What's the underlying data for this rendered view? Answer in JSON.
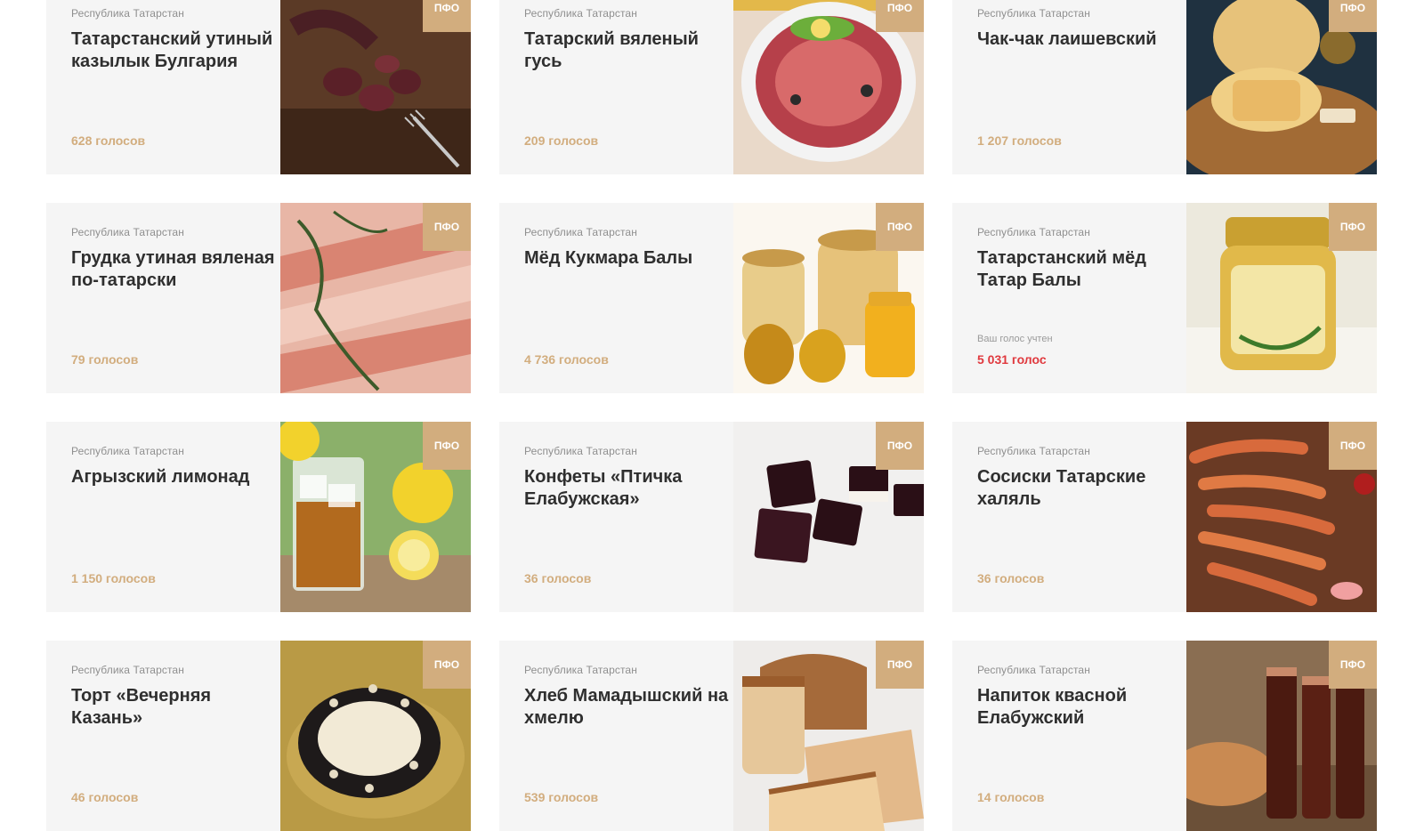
{
  "cards": [
    {
      "region": "Республика Татарстан",
      "title": "Татарстанский утиный казылык Булгария",
      "votes": "628 голосов",
      "badge": "ПФО",
      "photo": "sausage-photo",
      "voted_label": ""
    },
    {
      "region": "Республика Татарстан",
      "title": "Татарский вяленый гусь",
      "votes": "209 голосов",
      "badge": "ПФО",
      "photo": "goose-photo",
      "voted_label": ""
    },
    {
      "region": "Республика Татарстан",
      "title": "Чак-чак лаишевский",
      "votes": "1 207 голосов",
      "badge": "ПФО",
      "photo": "chak-chak-photo",
      "voted_label": ""
    },
    {
      "region": "Республика Татарстан",
      "title": "Грудка утиная вяленая по-татарски",
      "votes": "79 голосов",
      "badge": "ПФО",
      "photo": "duck-breast-photo",
      "voted_label": ""
    },
    {
      "region": "Республика Татарстан",
      "title": "Мёд Кукмара Балы",
      "votes": "4 736 голосов",
      "badge": "ПФО",
      "photo": "honey-kukmara-photo",
      "voted_label": ""
    },
    {
      "region": "Республика Татарстан",
      "title": "Татарстанский мёд Татар Балы",
      "votes": "5 031 голос",
      "badge": "ПФО",
      "photo": "honey-jar-photo",
      "voted_label": "Ваш голос учтен"
    },
    {
      "region": "Республика Татарстан",
      "title": "Агрызский лимонад",
      "votes": "1 150 голосов",
      "badge": "ПФО",
      "photo": "lemonade-photo",
      "voted_label": ""
    },
    {
      "region": "Республика Татарстан",
      "title": "Конфеты «Птичка Елабужская»",
      "votes": "36 голосов",
      "badge": "ПФО",
      "photo": "candy-photo",
      "voted_label": ""
    },
    {
      "region": "Республика Татарстан",
      "title": "Сосиски Татарские халяль",
      "votes": "36 голосов",
      "badge": "ПФО",
      "photo": "sausages-photo",
      "voted_label": ""
    },
    {
      "region": "Республика Татарстан",
      "title": "Торт «Вечерняя Казань»",
      "votes": "46 голосов",
      "badge": "ПФО",
      "photo": "cake-photo",
      "voted_label": ""
    },
    {
      "region": "Республика Татарстан",
      "title": "Хлеб Мамадышский на хмелю",
      "votes": "539 голосов",
      "badge": "ПФО",
      "photo": "bread-photo",
      "voted_label": ""
    },
    {
      "region": "Республика Татарстан",
      "title": "Напиток квасной Елабужский",
      "votes": "14 голосов",
      "badge": "ПФО",
      "photo": "kvass-photo",
      "voted_label": ""
    }
  ],
  "colors": {
    "accent": "#d2ad7e",
    "voted": "#e0393e",
    "card_bg": "#f5f5f5",
    "title": "#2f2f2f",
    "region": "#8f8f8f"
  }
}
